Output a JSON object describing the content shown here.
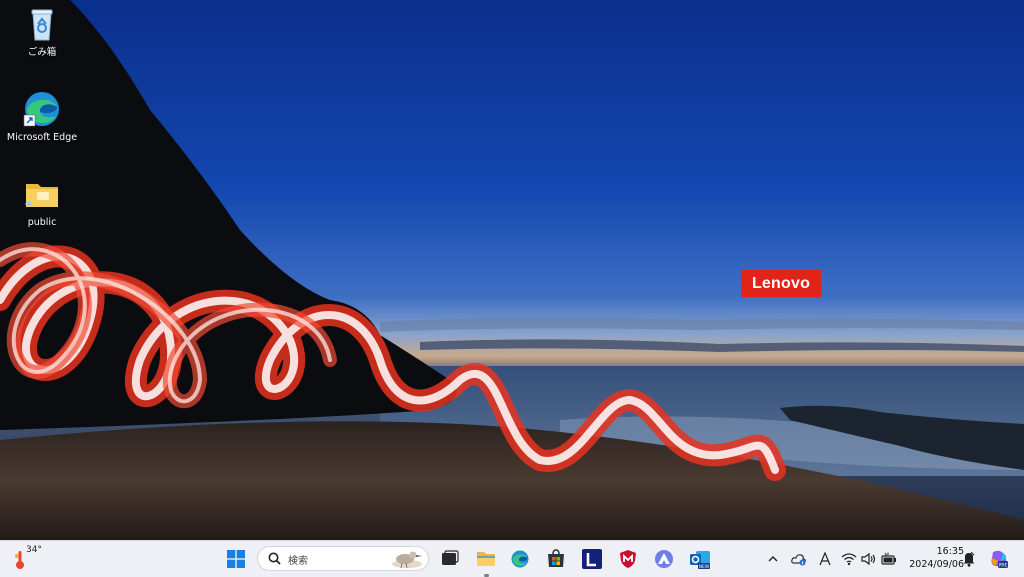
{
  "desktop": {
    "icons": [
      {
        "label": "ごみ箱",
        "icon": "recycle-bin-icon"
      },
      {
        "label": "Microsoft Edge",
        "icon": "edge-icon"
      },
      {
        "label": "public",
        "icon": "folder-icon"
      }
    ],
    "brand_badge": "Lenovo",
    "brand_color": "#e2231a"
  },
  "taskbar": {
    "weather": {
      "temperature": "34°"
    },
    "search": {
      "placeholder": "検索"
    },
    "pinned": [
      {
        "name": "start-icon"
      },
      {
        "name": "task-view-icon"
      },
      {
        "name": "file-explorer-icon"
      },
      {
        "name": "edge-icon"
      },
      {
        "name": "microsoft-store-icon"
      },
      {
        "name": "lenovo-vantage-icon"
      },
      {
        "name": "mcafee-icon"
      },
      {
        "name": "arc-app-icon"
      },
      {
        "name": "outlook-new-icon"
      }
    ],
    "tray": {
      "clock_time": "16:35",
      "clock_date": "2024/09/06"
    }
  }
}
